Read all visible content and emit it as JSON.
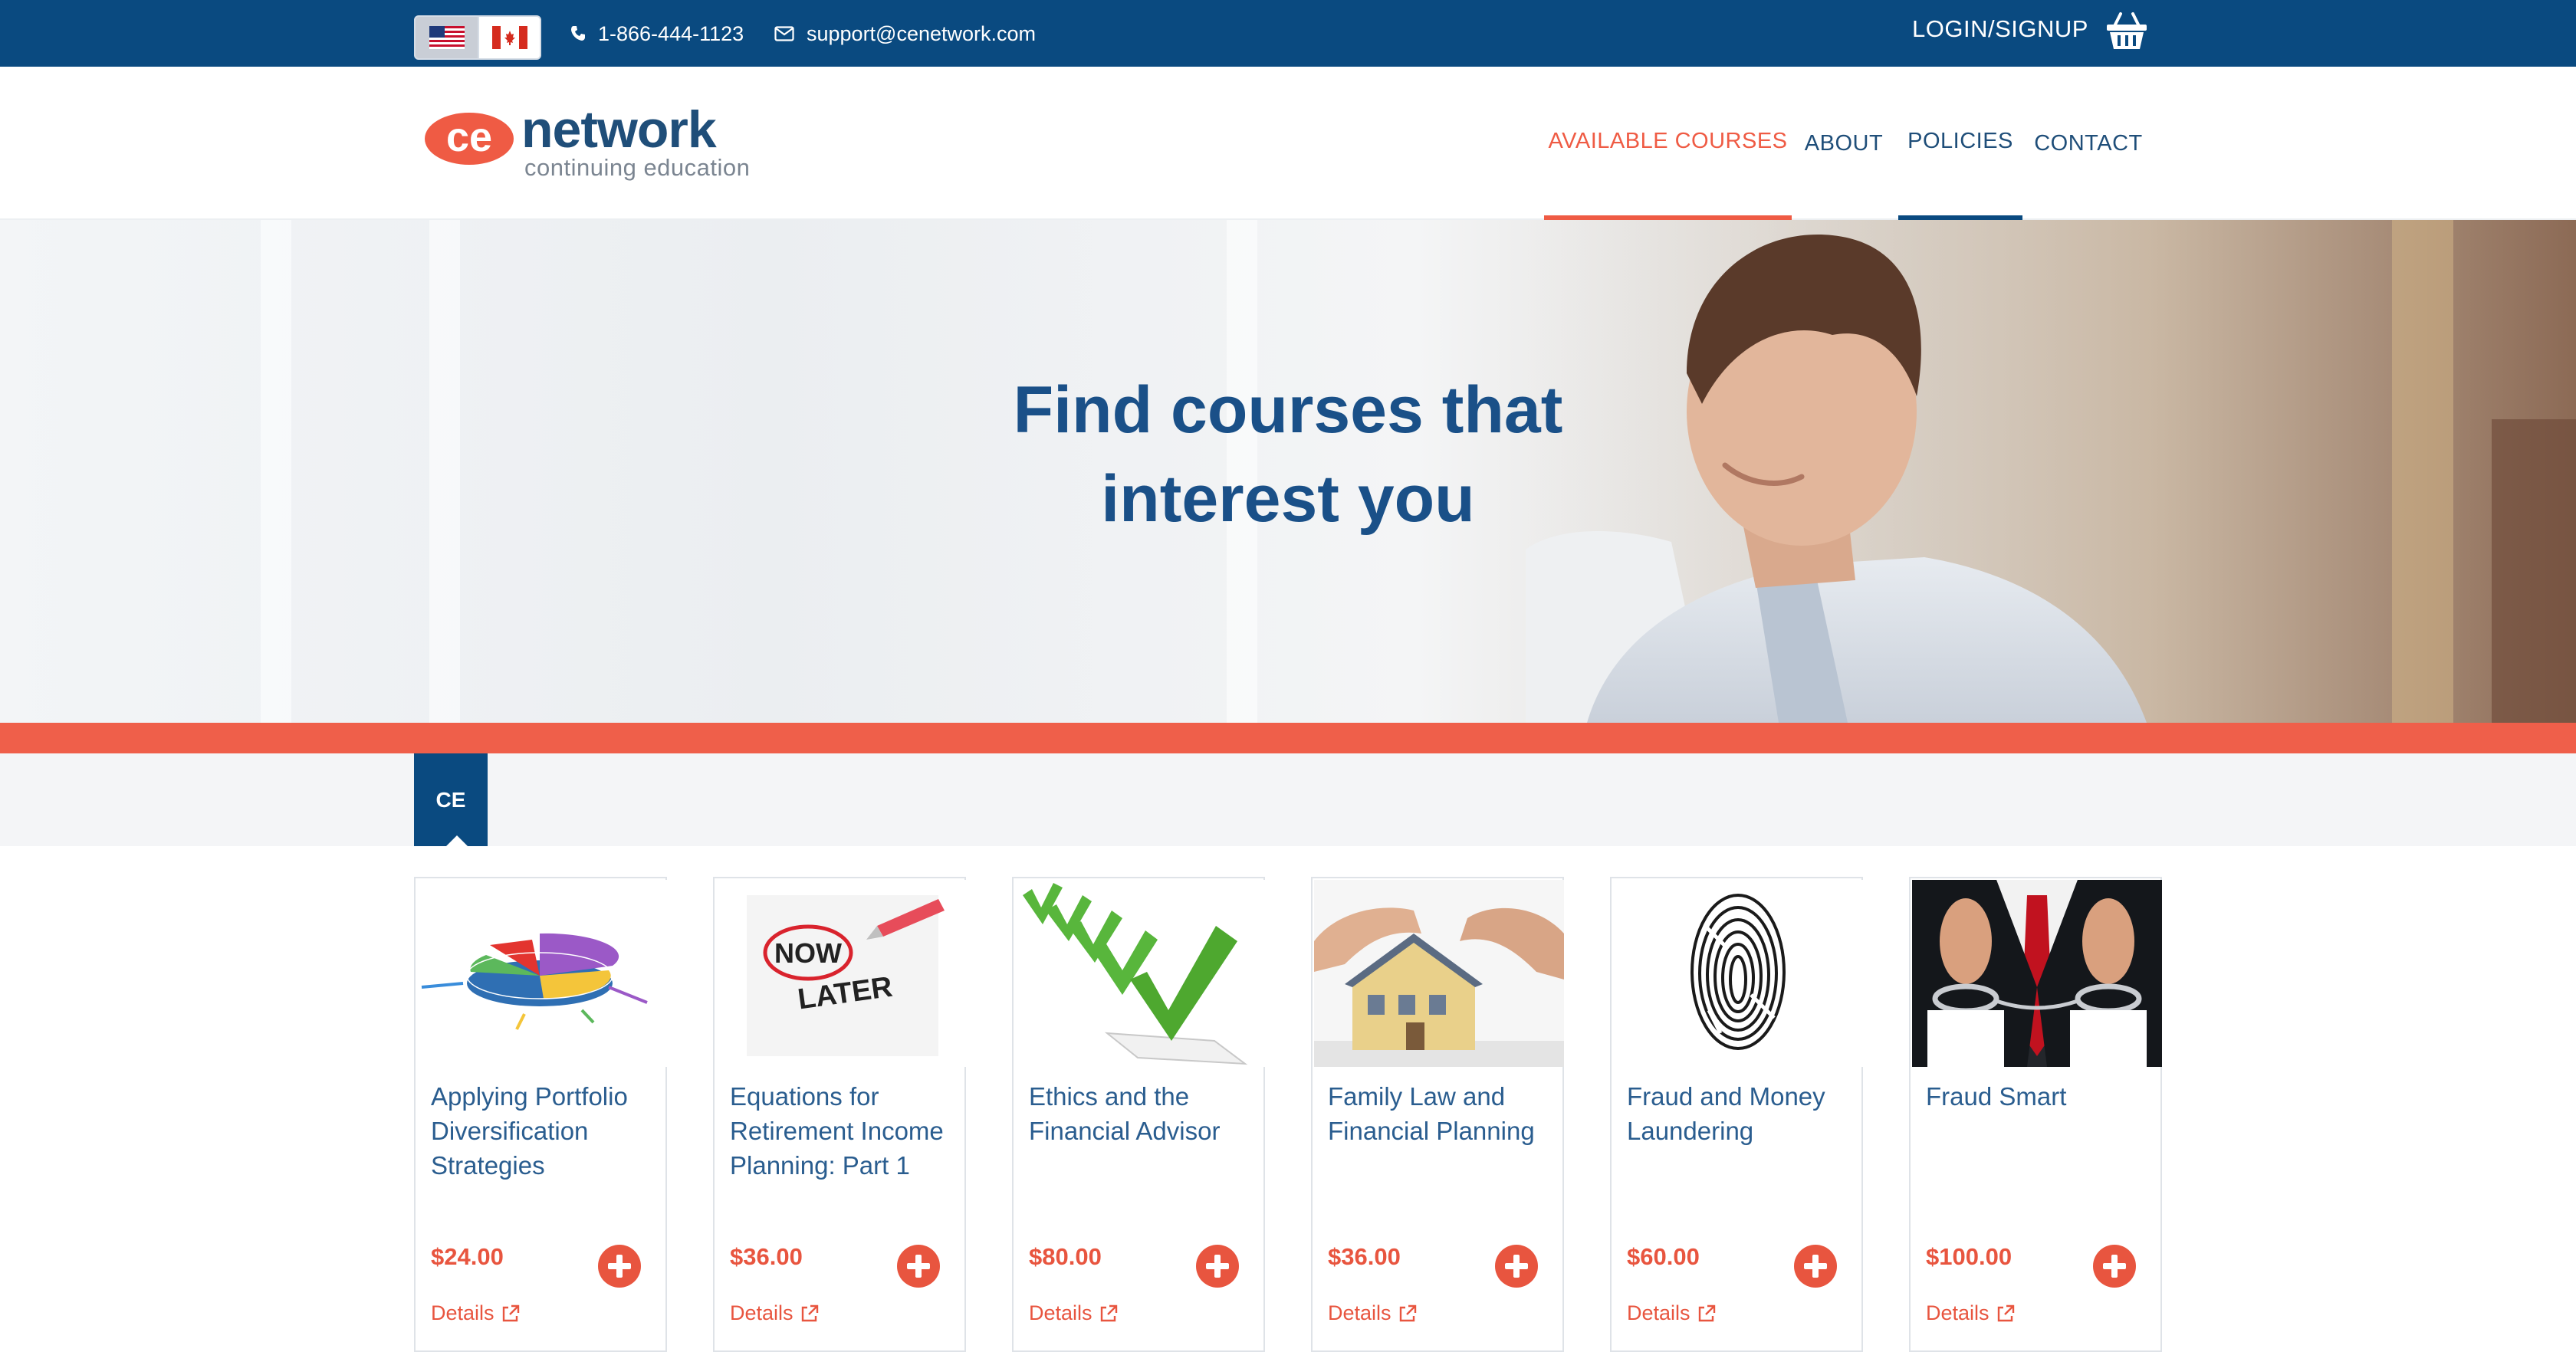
{
  "topbar": {
    "flags": [
      "flag-us-icon",
      "flag-canada-icon"
    ],
    "phone": "1-866-444-1123",
    "email": "support@cenetwork.com",
    "login": "LOGIN/SIGNUP"
  },
  "logo": {
    "mark": "ce",
    "name": "network",
    "tagline": "continuing education"
  },
  "nav": {
    "items": [
      {
        "label": "AVAILABLE COURSES",
        "state": "active"
      },
      {
        "label": "ABOUT",
        "state": "normal"
      },
      {
        "label": "POLICIES",
        "state": "underlined"
      },
      {
        "label": "CONTACT",
        "state": "normal"
      }
    ]
  },
  "hero": {
    "line1": "Find courses that",
    "line2": "interest you"
  },
  "tabs": {
    "active": "CE"
  },
  "courses": [
    {
      "title": "Applying Portfolio Diversification Strategies",
      "price": "$24.00",
      "details": "Details",
      "image": "pie-chart-image"
    },
    {
      "title": "Equations for Retirement Income Planning: Part 1",
      "price": "$36.00",
      "details": "Details",
      "image": "now-later-image"
    },
    {
      "title": "Ethics and the Financial Advisor",
      "price": "$80.00",
      "details": "Details",
      "image": "checkmarks-image"
    },
    {
      "title": "Family Law and Financial Planning",
      "price": "$36.00",
      "details": "Details",
      "image": "house-hands-image"
    },
    {
      "title": "Fraud and Money Laundering",
      "price": "$60.00",
      "details": "Details",
      "image": "fingerprint-image"
    },
    {
      "title": "Fraud Smart",
      "price": "$100.00",
      "details": "Details",
      "image": "handcuffs-image"
    }
  ],
  "colors": {
    "primary": "#0a4a80",
    "accent": "#ef5b44",
    "title_text": "#2a5d8f"
  }
}
